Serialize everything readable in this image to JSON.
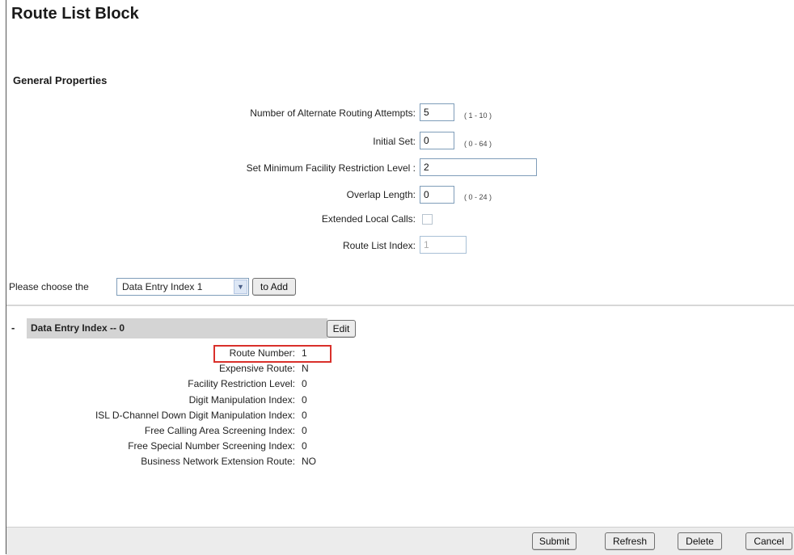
{
  "page_title": "Route List Block",
  "general_properties": {
    "title": "General Properties",
    "alt_routing_attempts": {
      "label": "Number of Alternate Routing Attempts:",
      "value": "5",
      "range": "( 1 - 10 )"
    },
    "initial_set": {
      "label": "Initial Set:",
      "value": "0",
      "range": "( 0 - 64 )"
    },
    "min_facility_restriction": {
      "label": "Set Minimum Facility Restriction Level :",
      "value": "2"
    },
    "overlap_length": {
      "label": "Overlap Length:",
      "value": "0",
      "range": "( 0 - 24 )"
    },
    "extended_local_calls": {
      "label": "Extended Local Calls:",
      "checked": false
    },
    "route_list_index": {
      "label": "Route List Index:",
      "value": "1"
    }
  },
  "chooser": {
    "label": "Please choose the",
    "selected": "Data Entry Index 1",
    "add_button": "to Add"
  },
  "entry": {
    "collapse_symbol": "-",
    "header": "Data Entry Index -- 0",
    "edit_button": "Edit",
    "details": [
      {
        "label": "Route Number:",
        "value": "1"
      },
      {
        "label": "Expensive Route:",
        "value": "N"
      },
      {
        "label": "Facility Restriction Level:",
        "value": "0"
      },
      {
        "label": "Digit Manipulation Index:",
        "value": "0"
      },
      {
        "label": "ISL D-Channel Down Digit Manipulation Index:",
        "value": "0"
      },
      {
        "label": "Free Calling Area Screening Index:",
        "value": "0"
      },
      {
        "label": "Free Special Number Screening Index:",
        "value": "0"
      },
      {
        "label": "Business Network Extension Route:",
        "value": "NO"
      }
    ]
  },
  "footer": {
    "submit": "Submit",
    "refresh": "Refresh",
    "delete": "Delete",
    "cancel": "Cancel"
  },
  "colors": {
    "highlight_box": "#d9302b",
    "header_bg": "#d4d4d4",
    "footer_bg": "#ececec"
  }
}
